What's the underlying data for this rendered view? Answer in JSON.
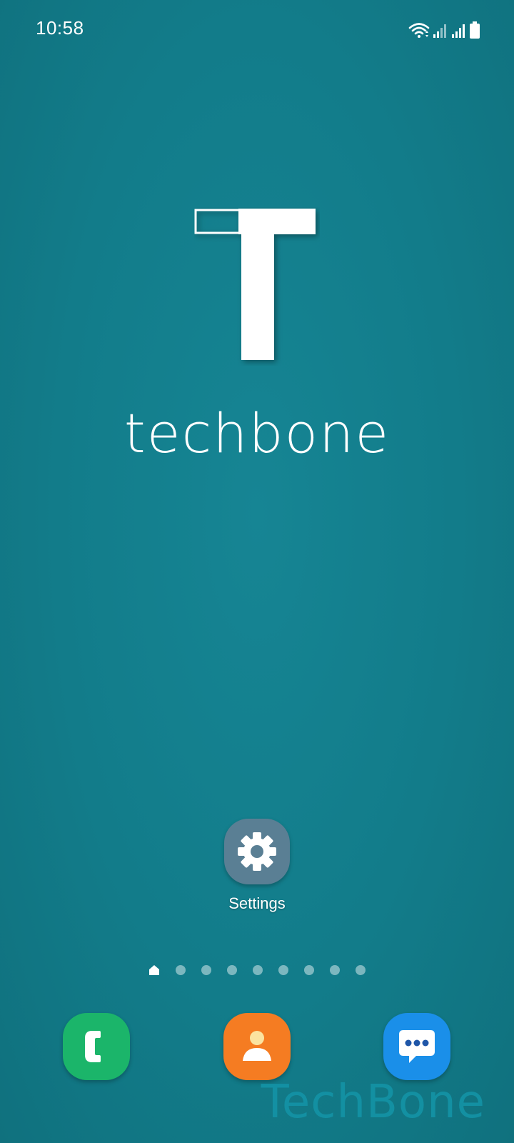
{
  "status_bar": {
    "time": "10:58",
    "icons": [
      "wifi-icon",
      "signal-icon-1",
      "signal-icon-2",
      "battery-icon"
    ]
  },
  "wallpaper": {
    "brand_text": "techbone",
    "logo_icon": "techbone-t-logo"
  },
  "home_apps": [
    {
      "label": "Settings",
      "icon": "gear-icon"
    }
  ],
  "page_indicator": {
    "pages": 9,
    "current": 1,
    "home_icon": "home-icon"
  },
  "dock": {
    "apps": [
      {
        "name": "phone",
        "icon": "phone-icon",
        "color": "#1bb56a"
      },
      {
        "name": "contacts",
        "icon": "contact-icon",
        "color": "#f57c22"
      },
      {
        "name": "messages",
        "icon": "message-icon",
        "color": "#1a8fe9"
      }
    ]
  },
  "watermark": "TechBone",
  "colors": {
    "background": "#127b89",
    "settings_tile": "#5a7f94"
  }
}
